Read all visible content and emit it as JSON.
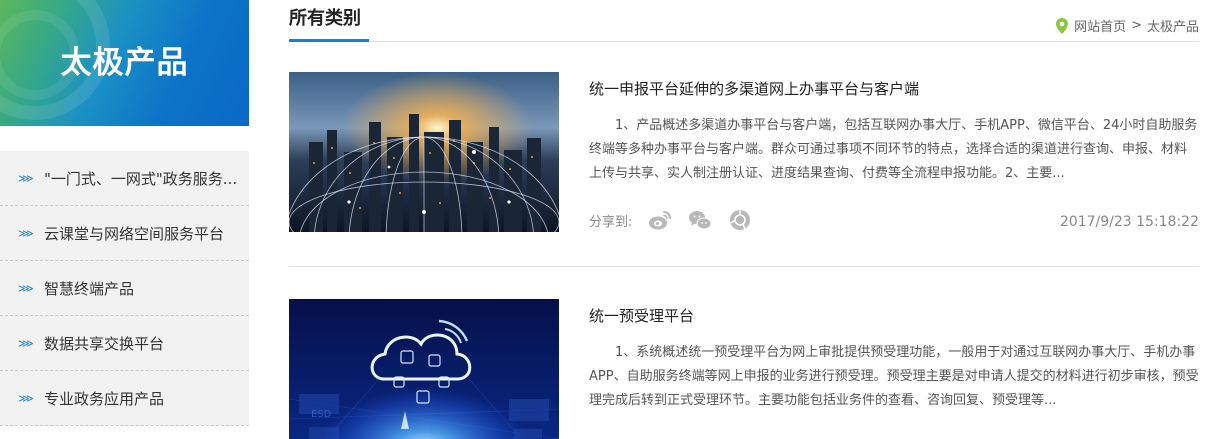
{
  "sidebar": {
    "title": "太极产品",
    "items": [
      {
        "label": "\"一门式、一网式\"政务服务..."
      },
      {
        "label": "云课堂与网络空间服务平台"
      },
      {
        "label": "智慧终端产品"
      },
      {
        "label": "数据共享交换平台"
      },
      {
        "label": "专业政务应用产品"
      }
    ]
  },
  "header": {
    "title": "所有类别",
    "breadcrumb": {
      "home": "网站首页",
      "separator": ">",
      "current": "太极产品"
    }
  },
  "articles": [
    {
      "title": "统一申报平台延伸的多渠道网上办事平台与客户端",
      "body": "1、产品概述多渠道办事平台与客户端，包括互联网办事大厅、手机APP、微信平台、24小时自助服务终端等多种办事平台与客户端。群众可通过事项不同环节的特点，选择合适的渠道进行查询、申报、材料上传与共享、实人制注册认证、进度结果查询、付费等全流程申报功能。2、主要...",
      "share_label": "分享到:",
      "date": "2017/9/23 15:18:22"
    },
    {
      "title": "统一预受理平台",
      "body": "1、系统概述统一预受理平台为网上审批提供预受理功能，一般用于对通过互联网办事大厅、手机办事APP、自助服务终端等网上申报的业务进行预受理。预受理主要是对申请人提交的材料进行初步审核，预受理完成后转到正式受理环节。主要功能包括业务件的查看、咨询回复、预受理等..."
    }
  ],
  "icons": {
    "sidebar_arrow": "double-chevron-right-icon",
    "breadcrumb": "location-pin-icon",
    "share": [
      "weibo-icon",
      "wechat-icon",
      "friends-circle-icon"
    ]
  },
  "colors": {
    "accent": "#1a7fd0",
    "pin": "#8cc63f",
    "sidebar_bg": "#f2f2f2"
  }
}
